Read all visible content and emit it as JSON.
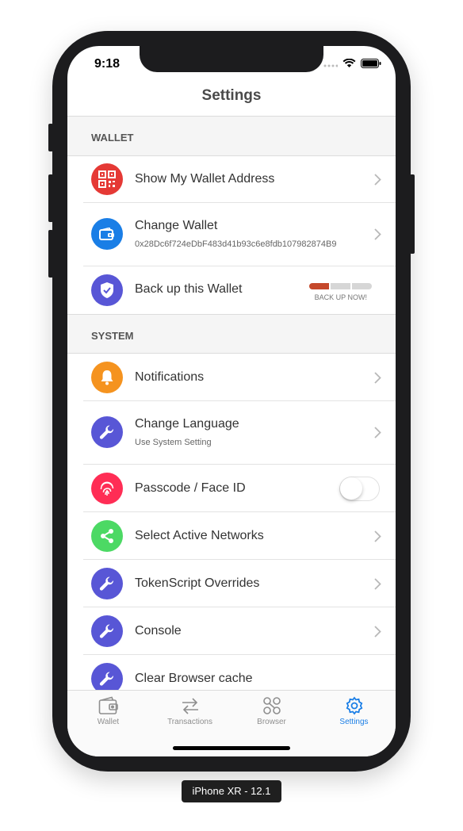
{
  "status_bar": {
    "time": "9:18"
  },
  "nav": {
    "title": "Settings"
  },
  "sections": {
    "wallet": "WALLET",
    "system": "SYSTEM"
  },
  "wallet_rows": {
    "show_address": {
      "title": "Show My Wallet Address",
      "icon": "qr-code-icon",
      "color": "#e53935"
    },
    "change_wallet": {
      "title": "Change Wallet",
      "subtitle": "0x28Dc6f724eDbF483d41b93c6e8fdb107982874B9",
      "icon": "wallet-icon",
      "color": "#1a7ee6"
    },
    "backup": {
      "title": "Back up this Wallet",
      "badge": "BACK UP NOW!",
      "icon": "shield-icon",
      "color": "#5856d6",
      "progress_segments": 3,
      "progress_filled": 1
    }
  },
  "system_rows": {
    "notifications": {
      "title": "Notifications",
      "icon": "bell-icon",
      "color": "#f5931f"
    },
    "language": {
      "title": "Change Language",
      "subtitle": "Use System Setting",
      "icon": "wrench-icon",
      "color": "#5856d6"
    },
    "passcode": {
      "title": "Passcode / Face ID",
      "icon": "fingerprint-icon",
      "color": "#ff2d55",
      "enabled": false
    },
    "networks": {
      "title": "Select Active Networks",
      "icon": "share-icon",
      "color": "#4cd964"
    },
    "tokenscript": {
      "title": "TokenScript Overrides",
      "icon": "wrench-icon",
      "color": "#5856d6"
    },
    "console": {
      "title": "Console",
      "icon": "wrench-icon",
      "color": "#5856d6"
    },
    "clear_cache": {
      "title": "Clear Browser cache",
      "icon": "wrench-icon",
      "color": "#5856d6"
    }
  },
  "tabbar": {
    "wallet": "Wallet",
    "transactions": "Transactions",
    "browser": "Browser",
    "settings": "Settings",
    "active": "settings",
    "active_color": "#1a7ee6"
  },
  "device_label": "iPhone XR - 12.1"
}
